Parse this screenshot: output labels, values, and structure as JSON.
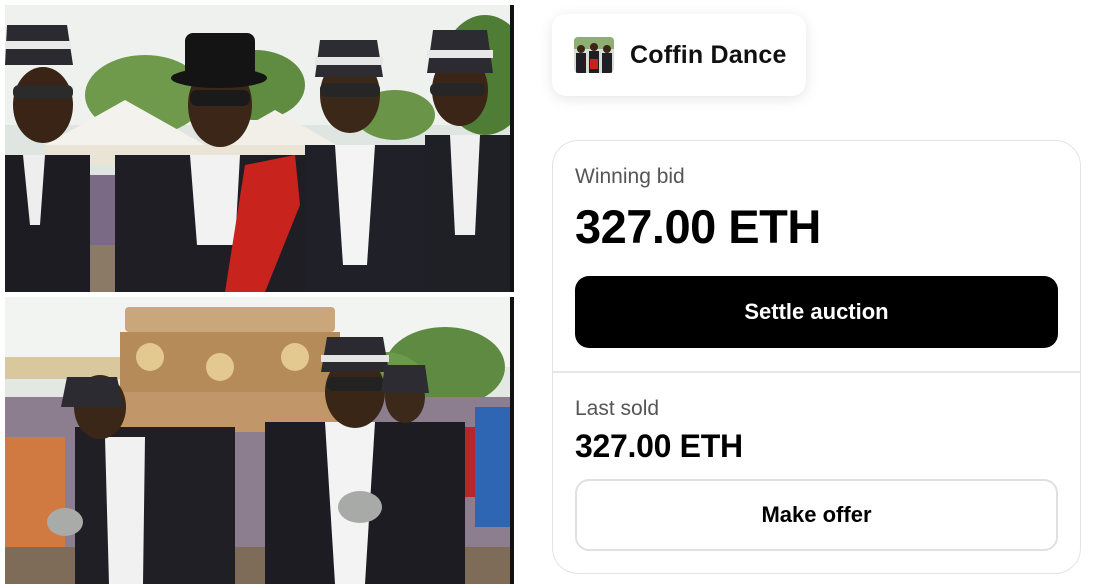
{
  "collection": {
    "title": "Coffin Dance",
    "thumbnail_icon": "pallbearers-thumbnail"
  },
  "auction": {
    "winning_bid_label": "Winning bid",
    "winning_bid_value": "327.00 ETH",
    "settle_button_label": "Settle auction",
    "last_sold_label": "Last sold",
    "last_sold_value": "327.00 ETH",
    "offer_button_label": "Make offer"
  },
  "images": {
    "top_photo": "pallbearers-standing-photo",
    "bottom_photo": "pallbearers-carrying-coffin-photo"
  },
  "colors": {
    "primary_button_bg": "#000000",
    "primary_button_text": "#ffffff",
    "secondary_button_border": "#e0e0e0",
    "card_border": "#e3e3e3",
    "label_text": "#555555"
  }
}
